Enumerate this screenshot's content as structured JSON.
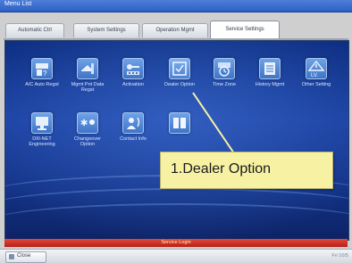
{
  "window": {
    "title": "Menu List"
  },
  "tabs": [
    {
      "label": "Automatic Ctrl"
    },
    {
      "label": "System Settings"
    },
    {
      "label": "Operation Mgmt"
    },
    {
      "label": "Service Settings"
    }
  ],
  "tiles": [
    {
      "label": "A/C Auto Regst"
    },
    {
      "label": "Mgmt Pnt Data Regst"
    },
    {
      "label": "Activation"
    },
    {
      "label": "Dealer Option"
    },
    {
      "label": "Time Zone"
    },
    {
      "label": "History Mgmt"
    },
    {
      "label": "Other Setting"
    },
    {
      "label": "DIII-NET Engineering"
    },
    {
      "label": "Changeover Option"
    },
    {
      "label": "Contact Info"
    },
    {
      "label": ""
    }
  ],
  "callout": {
    "text": "1.Dealer Option"
  },
  "service_bar": {
    "label": "Service Login"
  },
  "bottom": {
    "close_label": "Close",
    "datetime": "Fri 10/5"
  },
  "colors": {
    "panel": "#123184",
    "callout": "#f7f2a3",
    "service_bar": "#c42a1f"
  }
}
